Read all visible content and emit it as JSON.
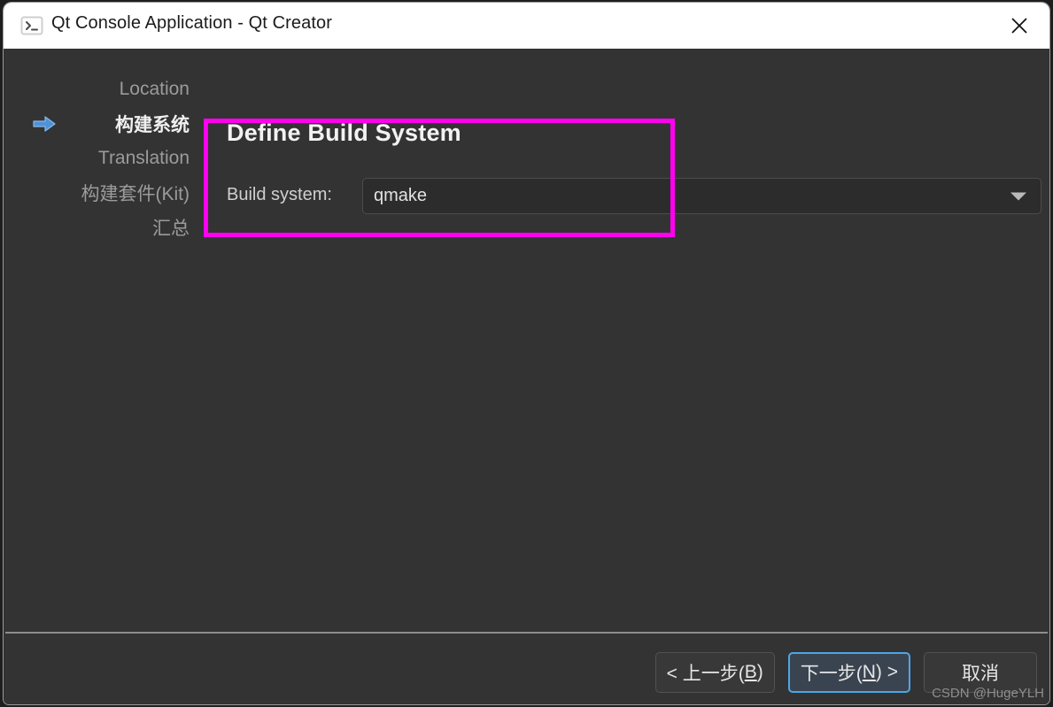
{
  "window": {
    "title": "Qt Console Application - Qt Creator",
    "title_icon": "console-icon",
    "close_icon": "close-icon"
  },
  "sidebar": {
    "items": [
      {
        "label": "Location",
        "active": false
      },
      {
        "label": "构建系统",
        "active": true
      },
      {
        "label": "Translation",
        "active": false
      },
      {
        "label": "构建套件(Kit)",
        "active": false
      },
      {
        "label": "汇总",
        "active": false
      }
    ],
    "active_arrow_icon": "arrow-right-icon"
  },
  "main": {
    "page_title": "Define Build System",
    "field_label": "Build system:",
    "build_system_value": "qmake",
    "build_system_options": [
      "qmake"
    ],
    "dropdown_icon": "chevron-down-icon"
  },
  "annotation": {
    "color": "#ff00f0",
    "shape": "rectangle"
  },
  "footer": {
    "buttons": [
      {
        "label": "< 上一步(B)",
        "pre": "< 上一步(",
        "mnemonic": "B",
        "post": ")",
        "focused": false
      },
      {
        "label": "下一步(N) >",
        "pre": "下一步(",
        "mnemonic": "N",
        "post": ") >",
        "focused": true
      },
      {
        "label": "取消",
        "pre": "取消",
        "mnemonic": "",
        "post": "",
        "focused": false
      }
    ]
  },
  "watermark": {
    "text": "CSDN @HugeYLH"
  }
}
